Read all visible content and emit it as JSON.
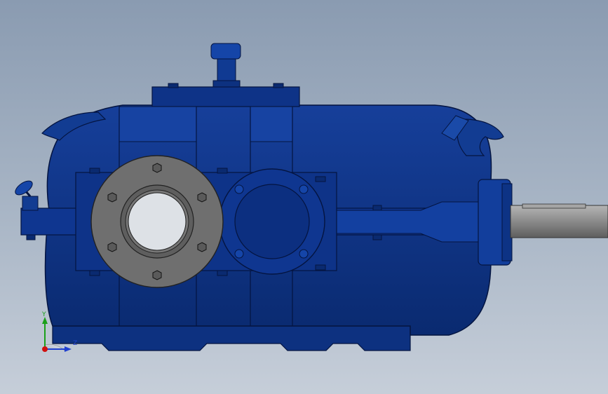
{
  "viewport": {
    "background_top": "#8a9bb1",
    "background_bottom": "#c6ced9"
  },
  "model": {
    "body_color": "#0b2f7a",
    "body_light": "#1540a0",
    "body_dark": "#071f55",
    "flange_color": "#6d6d6d",
    "shaft_color": "#8c8c8c",
    "bore_color": "#d9dde2"
  },
  "triad": {
    "y_label": "Y",
    "z_label": "Z",
    "y_color": "#1aa01a",
    "z_color": "#2040d0",
    "origin_color": "#d01010"
  }
}
